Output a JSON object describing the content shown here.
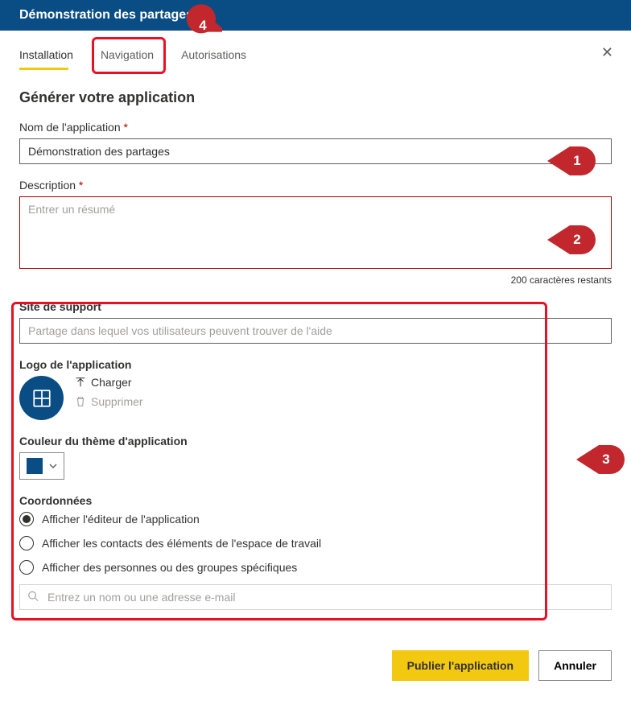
{
  "header": {
    "title": "Démonstration des partages"
  },
  "tabs": {
    "installation": "Installation",
    "navigation": "Navigation",
    "autorisations": "Autorisations"
  },
  "heading": "Générer votre application",
  "appName": {
    "label": "Nom de l'application",
    "value": "Démonstration des partages"
  },
  "description": {
    "label": "Description",
    "placeholder": "Entrer un résumé",
    "remaining": "200 caractères restants"
  },
  "supportSite": {
    "label": "Site de support",
    "placeholder": "Partage dans lequel vos utilisateurs peuvent trouver de l'aide"
  },
  "logo": {
    "label": "Logo de l'application",
    "upload": "Charger",
    "delete": "Supprimer"
  },
  "themeColor": {
    "label": "Couleur du thème d'application"
  },
  "contacts": {
    "label": "Coordonnées",
    "opt1": "Afficher l'éditeur de l'application",
    "opt2": "Afficher les contacts des éléments de l'espace de travail",
    "opt3": "Afficher des personnes ou des groupes spécifiques",
    "searchPlaceholder": "Entrez un nom ou une adresse e-mail"
  },
  "footer": {
    "publish": "Publier l'application",
    "cancel": "Annuler"
  },
  "callouts": {
    "c1": "1",
    "c2": "2",
    "c3": "3",
    "c4": "4"
  }
}
